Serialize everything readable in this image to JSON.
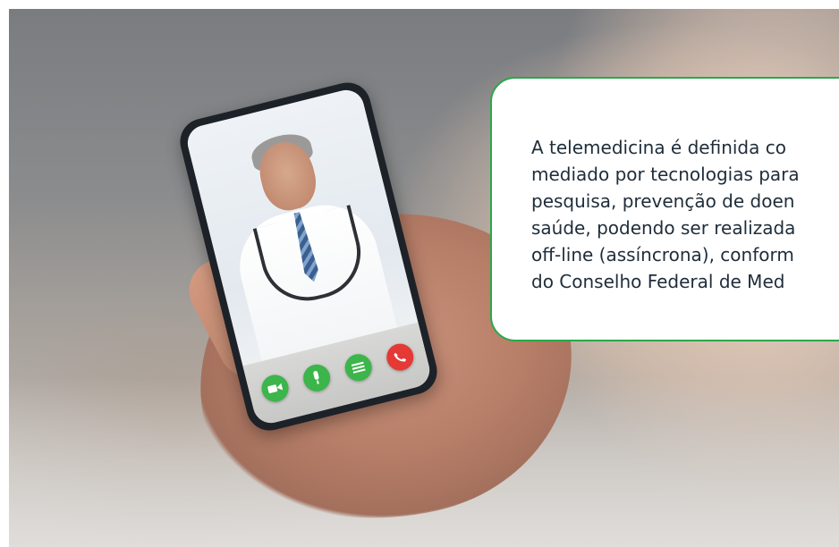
{
  "info_box": {
    "lines": [
      "A telemedicina é definida co",
      "mediado por tecnologias para",
      "pesquisa, prevenção de doen",
      "saúde, podendo ser realizada",
      "off-line (assíncrona), conform",
      "do Conselho Federal de Med"
    ],
    "border_color": "#2aa84a"
  },
  "call_controls": [
    {
      "icon": "video-camera-icon",
      "color": "#3cb54a"
    },
    {
      "icon": "microphone-icon",
      "color": "#3cb54a"
    },
    {
      "icon": "list-icon",
      "color": "#3cb54a"
    },
    {
      "icon": "phone-hangup-icon",
      "color": "#e53935"
    }
  ]
}
